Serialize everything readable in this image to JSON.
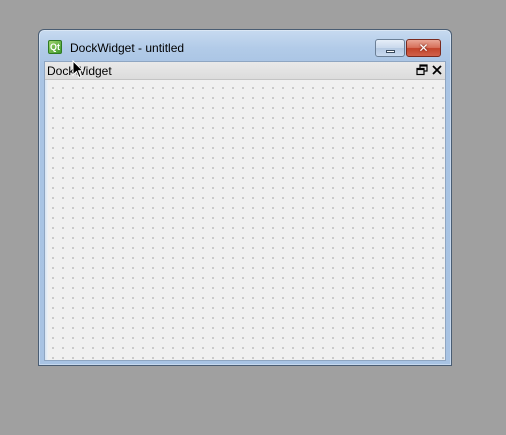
{
  "window": {
    "title": "DockWidget - untitled",
    "app_icon_glyph": "Qt",
    "app_icon_name": "qt-logo-icon",
    "minimize_icon": "minimize-icon",
    "close_icon": "close-icon",
    "close_glyph": "✕"
  },
  "dock": {
    "title": "DockWidget",
    "float_icon": "float-restore-icon",
    "close_icon": "close-icon"
  },
  "colors": {
    "desktop": "#a0a0a0",
    "titlebar": "#b2cbe8",
    "close_button": "#c2432a",
    "canvas": "#f0f0f0",
    "grid_dot": "#9a9a9a"
  }
}
